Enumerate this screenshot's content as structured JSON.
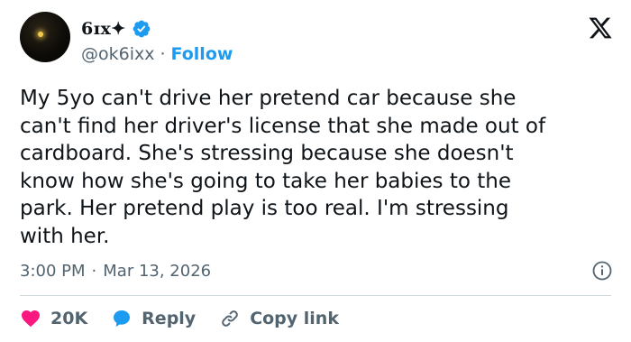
{
  "author": {
    "display_name": "6ɪx✦",
    "handle": "@ok6ixx",
    "separator": "·",
    "follow_label": "Follow"
  },
  "tweet": {
    "text": "My 5yo can't drive her pretend car because she\ncan't find her driver's license that she made out of\ncardboard. She's stressing because she doesn't\nknow how she's going to take her babies to the\npark. Her pretend play is too real. I'm stressing\nwith her."
  },
  "meta": {
    "time": "3:00 PM",
    "separator": "·",
    "date": "Mar 13, 2026"
  },
  "actions": {
    "like_count": "20K",
    "reply_label": "Reply",
    "copy_link_label": "Copy link"
  },
  "icons": {
    "verified": "verified-badge-icon",
    "brand": "x-logo-icon",
    "info": "info-icon",
    "like": "heart-icon",
    "reply": "speech-bubble-icon",
    "copy": "link-icon"
  },
  "colors": {
    "accent": "#1d9bf0",
    "like": "#f91880",
    "text": "#0f1419",
    "muted": "#536471",
    "divider": "#cfd9de"
  }
}
